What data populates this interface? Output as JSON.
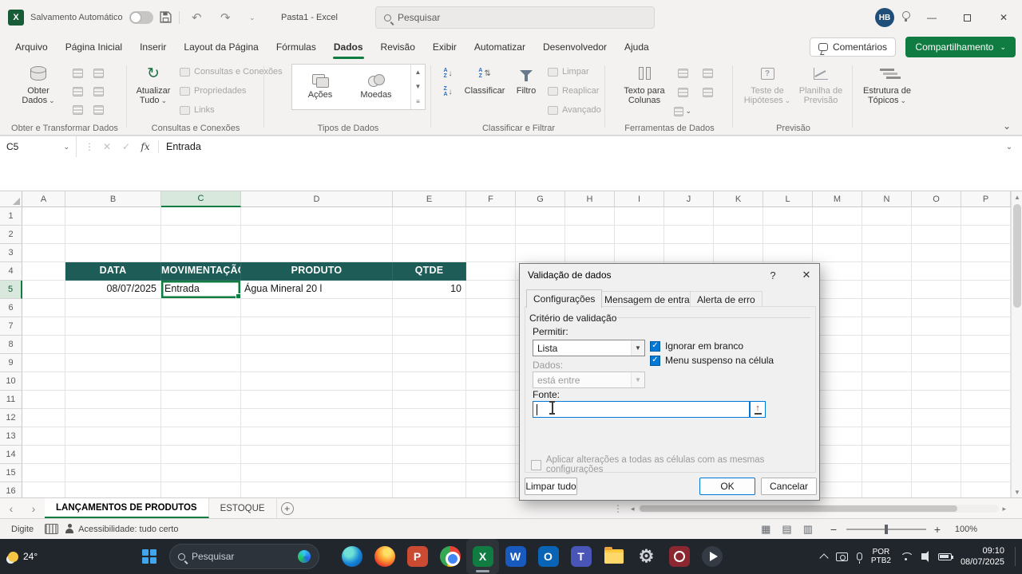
{
  "titlebar": {
    "autosave_label": "Salvamento Automático",
    "doc_title": "Pasta1 - Excel",
    "search_placeholder": "Pesquisar",
    "avatar_initials": "HB"
  },
  "ribbon": {
    "tabs": [
      {
        "label": "Arquivo"
      },
      {
        "label": "Página Inicial"
      },
      {
        "label": "Inserir"
      },
      {
        "label": "Layout da Página"
      },
      {
        "label": "Fórmulas"
      },
      {
        "label": "Dados"
      },
      {
        "label": "Revisão"
      },
      {
        "label": "Exibir"
      },
      {
        "label": "Automatizar"
      },
      {
        "label": "Desenvolvedor"
      },
      {
        "label": "Ajuda"
      }
    ],
    "active_tab": "Dados",
    "comments_label": "Comentários",
    "share_label": "Compartilhamento",
    "groups": {
      "get_transform": {
        "label": "Obter e Transformar Dados",
        "get_data": "Obter Dados"
      },
      "queries": {
        "label": "Consultas e Conexões",
        "refresh_all": "Atualizar Tudo",
        "items": [
          "Consultas e Conexões",
          "Propriedades",
          "Links"
        ]
      },
      "data_types": {
        "label": "Tipos de Dados",
        "items": [
          "Ações",
          "Moedas"
        ]
      },
      "sort_filter": {
        "label": "Classificar e Filtrar",
        "sort": "Classificar",
        "filter": "Filtro",
        "items": [
          "Limpar",
          "Reaplicar",
          "Avançado"
        ]
      },
      "data_tools": {
        "label": "Ferramentas de Dados",
        "text_to_columns": "Texto para Colunas"
      },
      "forecast": {
        "label": "Previsão",
        "what_if": "Teste de Hipóteses",
        "forecast_sheet": "Planilha de Previsão"
      },
      "outline": {
        "label": "Estrutura de Tópicos"
      }
    }
  },
  "formula_bar": {
    "name_box": "C5",
    "fx_label": "fx",
    "value": "Entrada"
  },
  "grid": {
    "columns": [
      "A",
      "B",
      "C",
      "D",
      "E",
      "F",
      "G",
      "H",
      "I",
      "J",
      "K",
      "L",
      "M",
      "N",
      "O",
      "P"
    ],
    "col_widths": {
      "A": 54,
      "B": 120,
      "C": 100,
      "D": 190,
      "E": 92,
      "default": 62
    },
    "row_count": 16,
    "selected": {
      "col": "C",
      "row": 5
    },
    "cells": [
      {
        "ref": "B4",
        "text": "DATA",
        "cls": "tbl-header"
      },
      {
        "ref": "C4",
        "text": "MOVIMENTAÇÃO",
        "cls": "tbl-header clip"
      },
      {
        "ref": "D4",
        "text": "PRODUTO",
        "cls": "tbl-header"
      },
      {
        "ref": "E4",
        "text": "QTDE",
        "cls": "tbl-header"
      },
      {
        "ref": "B5",
        "text": "08/07/2025",
        "cls": "right"
      },
      {
        "ref": "C5",
        "text": "Entrada",
        "cls": "left"
      },
      {
        "ref": "D5",
        "text": "Água Mineral 20 l",
        "cls": "left"
      },
      {
        "ref": "E5",
        "text": "10",
        "cls": "right"
      }
    ]
  },
  "dialog": {
    "title": "Validação de dados",
    "tabs": [
      "Configurações",
      "Mensagem de entrada",
      "Alerta de erro"
    ],
    "section_title": "Critério de validação",
    "allow_label": "Permitir:",
    "allow_value": "Lista",
    "ignore_blank_label": "Ignorar em branco",
    "in_cell_dropdown_label": "Menu suspenso na célula",
    "data_label": "Dados:",
    "data_value": "está entre",
    "source_label": "Fonte:",
    "source_value": "",
    "apply_all_label": "Aplicar alterações a todas as células com as mesmas configurações",
    "clear_all_button": "Limpar tudo",
    "ok_button": "OK",
    "cancel_button": "Cancelar"
  },
  "sheet_bar": {
    "tabs": [
      {
        "label": "LANÇAMENTOS DE PRODUTOS"
      },
      {
        "label": "ESTOQUE"
      }
    ]
  },
  "status_bar": {
    "mode": "Digite",
    "accessibility": "Acessibilidade: tudo certo",
    "zoom": "100%"
  },
  "taskbar": {
    "weather": "24°",
    "search_placeholder": "Pesquisar",
    "language_line1": "POR",
    "language_line2": "PTB2",
    "time": "09:10",
    "date": "08/07/2025"
  }
}
